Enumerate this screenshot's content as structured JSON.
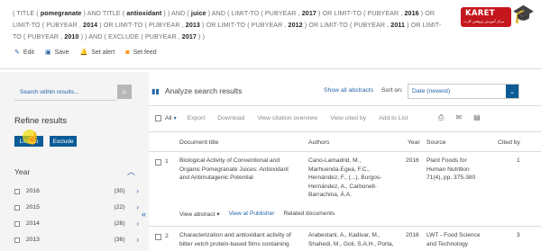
{
  "query": {
    "segments": [
      {
        "t": "( TITLE ( ",
        "b": false
      },
      {
        "t": "pomegranate",
        "b": true
      },
      {
        "t": " ) AND TITLE ( ",
        "b": false
      },
      {
        "t": "antioxidant",
        "b": true
      },
      {
        "t": " ) ) AND ( ",
        "b": false
      },
      {
        "t": "juice",
        "b": true
      },
      {
        "t": " ) AND ( LIMIT-TO ( PUBYEAR , ",
        "b": false
      },
      {
        "t": "2017",
        "b": true
      },
      {
        "t": " ) OR LIMIT-TO ( PUBYEAR , ",
        "b": false
      },
      {
        "t": "2016",
        "b": true
      },
      {
        "t": " ) OR LIMIT-TO ( PUBYEAR , ",
        "b": false
      },
      {
        "t": "2014",
        "b": true
      },
      {
        "t": " ) OR LIMIT-TO ( PUBYEAR , ",
        "b": false
      },
      {
        "t": "2013",
        "b": true
      },
      {
        "t": " ) OR LIMIT-TO ( PUBYEAR , ",
        "b": false
      },
      {
        "t": "2012",
        "b": true
      },
      {
        "t": " ) OR LIMIT-TO ( PUBYEAR , ",
        "b": false
      },
      {
        "t": "2011",
        "b": true
      },
      {
        "t": " ) OR LIMIT-TO ( PUBYEAR , ",
        "b": false
      },
      {
        "t": "2010",
        "b": true
      },
      {
        "t": " ) ) AND ( EXCLUDE ( PUBYEAR , ",
        "b": false
      },
      {
        "t": "2017",
        "b": true
      },
      {
        "t": " ) )",
        "b": false
      }
    ]
  },
  "logo": {
    "brand": "KARET",
    "tagline": "مرکز آموزش پژوهش کارت"
  },
  "actions": {
    "edit": "Edit",
    "save": "Save",
    "alert": "Set alert",
    "feed": "Set feed"
  },
  "sidebar": {
    "search_placeholder": "Search within results...",
    "refine": "Refine results",
    "limit_to": "Limit to",
    "exclude": "Exclude",
    "year_title": "Year",
    "years": [
      {
        "year": "2016",
        "count": "(30)"
      },
      {
        "year": "2015",
        "count": "(22)"
      },
      {
        "year": "2014",
        "count": "(26)"
      },
      {
        "year": "2013",
        "count": "(36)"
      }
    ]
  },
  "main": {
    "analyze": "Analyze search results",
    "show_all": "Show all abstracts",
    "sort_on": "Sort on:",
    "sort_value": "Date (newest)",
    "toolbar": {
      "all": "All",
      "export": "Export",
      "download": "Download",
      "citation": "View citation overview",
      "cited_by": "View cited by",
      "add_list": "Add to List"
    },
    "columns": {
      "title": "Document title",
      "authors": "Authors",
      "year": "Year",
      "source": "Source",
      "cited": "Cited by"
    },
    "rows": [
      {
        "num": "1",
        "title": [
          "Biological Activity of Conventional and",
          "Organic Pomegranate Juices: Antioxidant",
          "and Antimutagenic Potential"
        ],
        "authors": [
          "Cano-Lamadrid, M.,",
          "Marhuenda-Egea, F.C.,",
          "Hernández, F., (...), Burgos-",
          "Hernández, A., Carbonell-",
          "Barrachina, Á.A."
        ],
        "year": "2016",
        "source": [
          "Plant Foods for",
          "Human Nutrition",
          "71(4), pp. 375-380"
        ],
        "cited": "1"
      },
      {
        "num": "2",
        "title": [
          "Characterization and antioxidant activity of",
          "bitter vetch protein-based films containing"
        ],
        "authors": [
          "Arabestani, A., Kadivar, M.,",
          "Shahedi, M., Goli, S.A.H., Porta,"
        ],
        "year": "2016",
        "source": [
          "LWT - Food Science",
          "and Technology"
        ],
        "cited": "3"
      }
    ],
    "view_abstract": "View abstract",
    "view_publisher": "View at Publisher",
    "related": "Related documents"
  }
}
